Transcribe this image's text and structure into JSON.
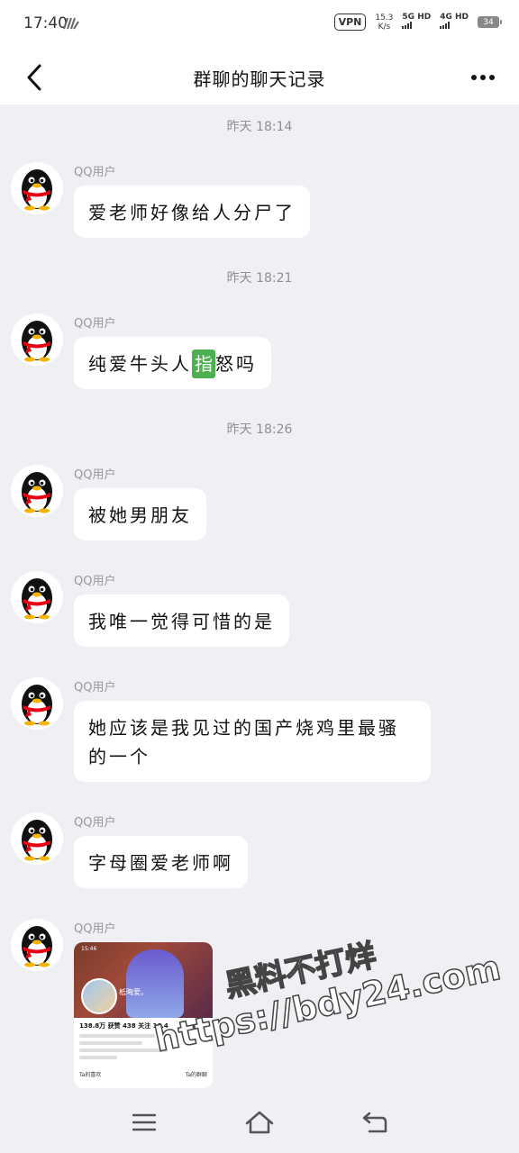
{
  "status_bar": {
    "time": "17:40",
    "vpn": "VPN",
    "speed_value": "15.3",
    "speed_unit": "K/s",
    "sim1": "5G HD",
    "sim2": "4G HD",
    "battery": "34"
  },
  "header": {
    "title": "群聊的聊天记录",
    "back_icon": "chevron-left-icon",
    "more_icon": "more-horizontal-icon"
  },
  "messages": [
    {
      "timestamp": "昨天 18:14",
      "sender": "QQ用户",
      "text": "爱老师好像给人分尸了"
    },
    {
      "timestamp": "昨天 18:21",
      "sender": "QQ用户",
      "text_before": "纯爱牛头人",
      "highlight": "指",
      "text_after": "怒吗"
    },
    {
      "timestamp": "昨天 18:26",
      "sender": "QQ用户",
      "text": "被她男朋友"
    },
    {
      "sender": "QQ用户",
      "text": "我唯一觉得可惜的是"
    },
    {
      "sender": "QQ用户",
      "text": "她应该是我见过的国产烧鸡里最骚的一个"
    },
    {
      "sender": "QQ用户",
      "text": "字母圈爱老师啊"
    },
    {
      "sender": "QQ用户",
      "image": {
        "time": "15:46",
        "name": "柢晦爱。",
        "stats": "138.8万 获赞  438 关注  16.4",
        "link1": "Ta的喜欢",
        "link2": "Ta的群聊"
      }
    }
  ],
  "watermark": {
    "line1": "黑料不打烊",
    "line2": "https://bdy24.com"
  },
  "bottom_nav": {
    "menu_icon": "menu-icon",
    "home_icon": "home-icon",
    "back_icon": "back-icon"
  },
  "colors": {
    "background": "#efeff4",
    "bubble": "#ffffff",
    "timestamp": "#8e8e93",
    "highlight": "#4caf50"
  }
}
